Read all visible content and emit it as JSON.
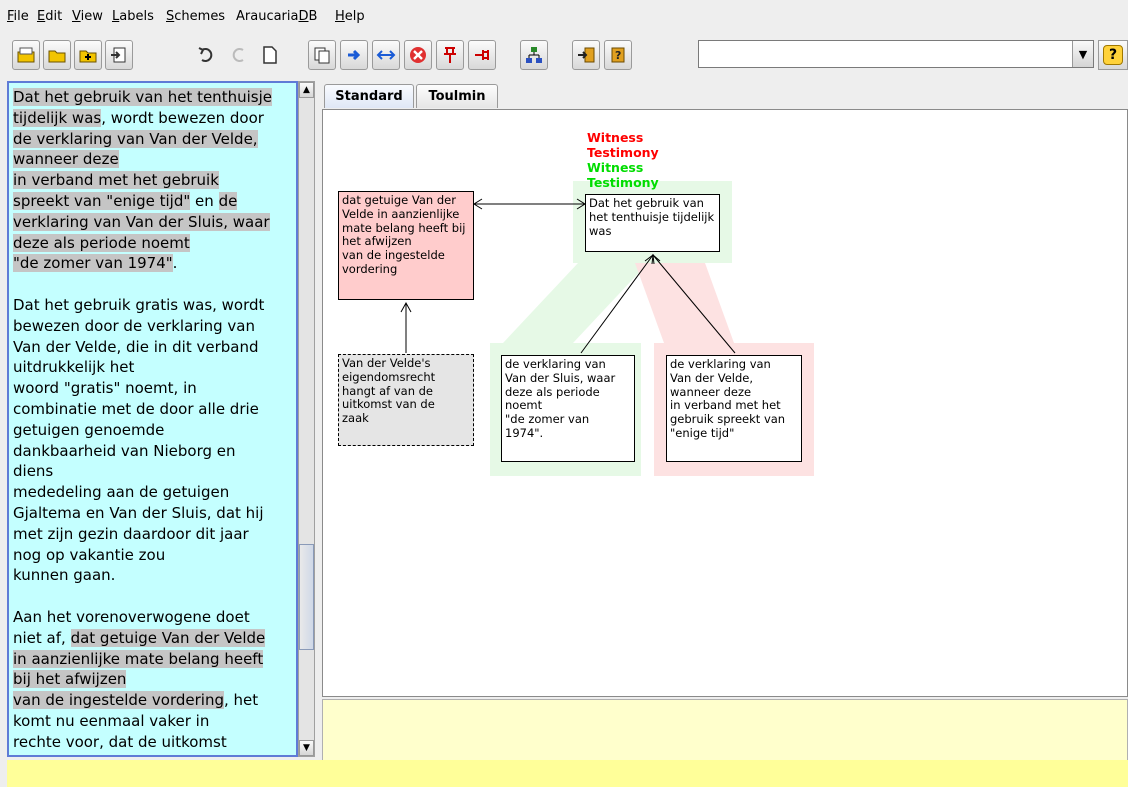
{
  "menubar": [
    {
      "label": "File",
      "mn": "F",
      "rest": "ile"
    },
    {
      "label": "Edit",
      "mn": "E",
      "rest": "dit"
    },
    {
      "label": "View",
      "mn": "V",
      "rest": "iew"
    },
    {
      "label": "Labels",
      "mn": "L",
      "rest": "abels"
    },
    {
      "label": "Schemes",
      "mn": "S",
      "rest": "chemes"
    },
    {
      "label": "AraucariaDB",
      "pre": "Araucaria",
      "mn": "D",
      "rest": "B"
    },
    {
      "label": "Help",
      "mn": "H",
      "rest": "elp"
    }
  ],
  "toolbar": {
    "buttons": [
      "open-icon",
      "open-folder-icon",
      "save-icon",
      "export-icon",
      "undo-icon",
      "redo-icon",
      "new-document-icon",
      "copy-icon",
      "link-icon",
      "swap-icon",
      "delete-icon",
      "pin-icon",
      "unpin-icon",
      "tree-icon",
      "db-upload-icon",
      "db-query-icon"
    ],
    "search_value": "",
    "help_label": "?"
  },
  "text_panel": {
    "paragraphs": [
      [
        {
          "t": "Dat het gebruik van het tenthuisje",
          "hl": true
        },
        {
          "t": "\n"
        },
        {
          "t": "tijdelijk was",
          "hl": true
        },
        {
          "t": ", wordt bewezen door\n"
        },
        {
          "t": "de verklaring van Van der Velde,",
          "hl": true
        },
        {
          "t": "\n"
        },
        {
          "t": "wanneer deze",
          "hl": true
        },
        {
          "t": "\n"
        },
        {
          "t": "in verband met het gebruik",
          "hl": true
        },
        {
          "t": "\n"
        },
        {
          "t": "spreekt van \"enige tijd\"",
          "hl": true
        },
        {
          "t": " en "
        },
        {
          "t": "de",
          "hl": true
        },
        {
          "t": "\n"
        },
        {
          "t": "verklaring van Van der Sluis, waar",
          "hl": true
        },
        {
          "t": "\n"
        },
        {
          "t": "deze als periode noemt",
          "hl": true
        },
        {
          "t": "\n"
        },
        {
          "t": "\"de zomer van 1974\"",
          "hl": true
        },
        {
          "t": "."
        }
      ],
      [
        {
          "t": "Dat het gebruik gratis was, wordt\nbewezen door de verklaring van\nVan der Velde, die in dit verband\nuitdrukkelijk het\nwoord \"gratis\" noemt, in\ncombinatie met de door alle drie\ngetuigen genoemde\ndankbaarheid van Nieborg en\ndiens\nmededeling aan de getuigen\nGjaltema en Van der Sluis, dat hij\nmet zijn gezin daardoor dit jaar\nnog op vakantie zou\nkunnen gaan."
        }
      ],
      [
        {
          "t": "Aan het vorenoverwogene doet\nniet af, "
        },
        {
          "t": "dat getuige Van der Velde",
          "hl": true
        },
        {
          "t": "\n"
        },
        {
          "t": "in aanzienlijke mate belang heeft",
          "hl": true
        },
        {
          "t": "\n"
        },
        {
          "t": "bij het afwijzen",
          "hl": true
        },
        {
          "t": "\n"
        },
        {
          "t": "van de ingestelde vordering",
          "hl": true
        },
        {
          "t": ", het\nkomt nu eenmaal vaker in\nrechte voor, dat de uitkomst"
        }
      ]
    ]
  },
  "tabs": [
    "Standard",
    "Toulmin"
  ],
  "diagram": {
    "scheme_labels": [
      {
        "text": "Witness",
        "color": "#ff0000"
      },
      {
        "text": "Testimony",
        "color": "#ff0000"
      },
      {
        "text": "Witness",
        "color": "#00dd00"
      },
      {
        "text": "Testimony",
        "color": "#00dd00"
      }
    ],
    "nodes": {
      "conclusion": "Dat het gebruik van\nhet tenthuisje tijdelijk\nwas",
      "rebuttal": "dat getuige Van der\nVelde in aanzienlijke\nmate belang heeft bij\nhet afwijzen\nvan de ingestelde\nvordering",
      "undercutter": "Van der Velde's\neigendomsrecht\nhangt af van de\nuitkomst van de\nzaak",
      "premise_sluis": "de verklaring van\nVan der Sluis, waar\ndeze als periode\nnoemt\n\"de zomer van\n1974\".",
      "premise_velde": "de verklaring van\nVan der Velde,\nwanneer deze\nin verband met het\ngebruik spreekt van\n\"enige tijd\""
    },
    "colors": {
      "rebuttal_fill": "#ffcccc",
      "undercutter_fill": "#e5e5e5",
      "green_highlight": "#e6f9e6",
      "red_highlight": "#fde2e2"
    }
  }
}
